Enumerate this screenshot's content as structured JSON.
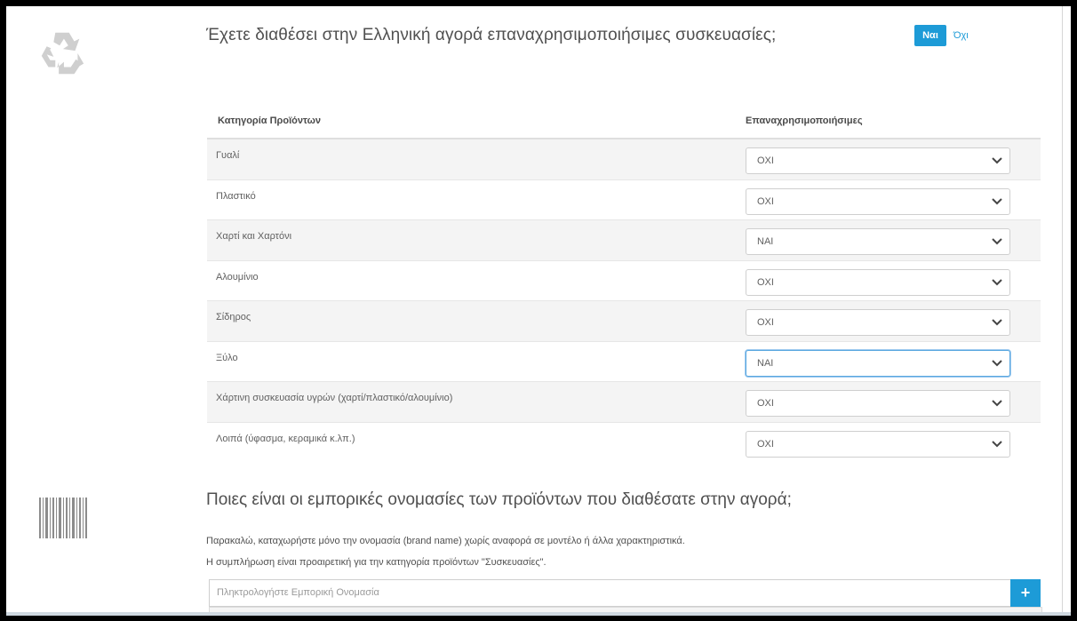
{
  "question1": "Έχετε διαθέσει στην Ελληνική αγορά επαναχρησιμοποιήσιμες συσκευασίες;",
  "toggle": {
    "yes_label": "Ναι",
    "no_label": "Όχι",
    "selected": "Ναι"
  },
  "colors": {
    "accent": "#1d9bd7",
    "border": "#cfcfcf",
    "row_alt": "#f4f4f4"
  },
  "table": {
    "headers": {
      "category": "Κατηγορία Προϊόντων",
      "reusable": "Επαναχρησιμοποιήσιμες"
    },
    "rows": [
      {
        "label": "Γυαλί",
        "value": "ΟΧΙ"
      },
      {
        "label": "Πλαστικό",
        "value": "ΟΧΙ"
      },
      {
        "label": "Χαρτί και Χαρτόνι",
        "value": "ΝΑΙ"
      },
      {
        "label": "Αλουμίνιο",
        "value": "ΟΧΙ"
      },
      {
        "label": "Σίδηρος",
        "value": "ΟΧΙ"
      },
      {
        "label": "Ξύλο",
        "value": "ΝΑΙ"
      },
      {
        "label": "Χάρτινη συσκευασία υγρών (χαρτί/πλαστικό/αλουμίνιο)",
        "value": "ΟΧΙ"
      },
      {
        "label": "Λοιπά (ύφασμα, κεραμικά κ.λπ.)",
        "value": "ΟΧΙ"
      }
    ]
  },
  "question2": "Ποιες είναι οι εμπορικές ονομασίες των προϊόντων που διαθέσατε στην αγορά;",
  "help": {
    "line1": "Παρακαλώ, καταχωρήστε μόνο την ονομασία (brand name) χωρίς αναφορά σε μοντέλο ή άλλα χαρακτηριστικά.",
    "line2": "Η συμπλήρωση είναι προαιρετική για την κατηγορία προϊόντων \"Συσκευασίες\"."
  },
  "brand_input": {
    "placeholder": "Πληκτρολογήστε Εμπορική Ονομασία",
    "add_label": "+"
  },
  "icons": {
    "recycle": "recycle-icon",
    "barcode": "barcode-icon",
    "chevron": "chevron-down-icon"
  }
}
